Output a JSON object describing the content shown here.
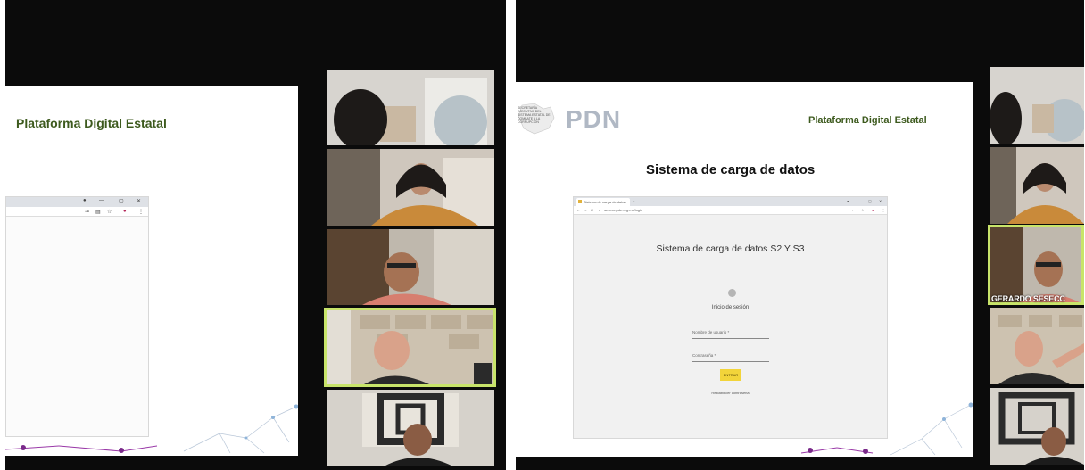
{
  "left_panel": {
    "slide_title": "Plataforma Digital Estatal",
    "browser_controls": {
      "minimize_glyph": "—",
      "maximize_glyph": "▢",
      "close_glyph": "✕"
    }
  },
  "right_panel": {
    "logo_text": "PDN",
    "seal_text": "SECRETARÍA EJECUTIVA DEL SISTEMA ESTATAL DE COMBATE A LA CORRUPCIÓN",
    "slide_title": "Plataforma Digital Estatal",
    "slide_heading": "Sistema de carga de datos",
    "browser": {
      "tab_label": "Sistema de carga de datos",
      "url": "sesecc.pde.org.mx/login"
    },
    "page": {
      "heading": "Sistema de carga de datos S2 Y S3",
      "login_title": "Inicio de sesión",
      "username_label": "Nombre de usuario *",
      "password_label": "Contraseña *",
      "submit_label": "ENTRAR",
      "reset_link": "Restablecer contraseña"
    },
    "active_participant_label": "GERARDO SESECC"
  },
  "colors": {
    "title_green": "#3d5a1e",
    "active_speaker_border": "#c8e46a",
    "submit_yellow": "#f2d43a",
    "background_dark": "#0b0b0b"
  }
}
